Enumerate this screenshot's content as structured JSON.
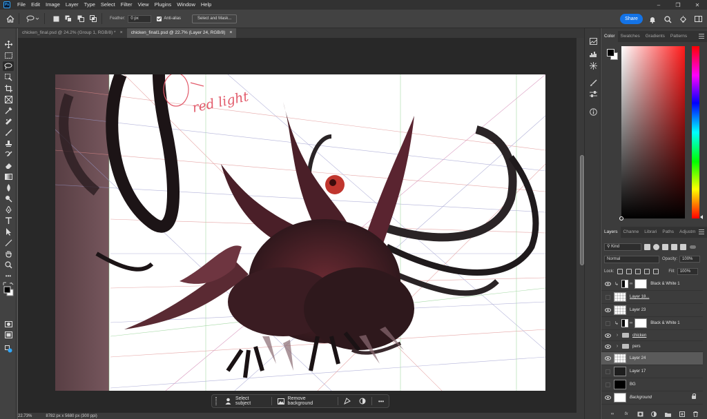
{
  "app": {
    "logo_text": "Ps",
    "menu": [
      "File",
      "Edit",
      "Image",
      "Layer",
      "Type",
      "Select",
      "Filter",
      "View",
      "Plugins",
      "Window",
      "Help"
    ],
    "window_controls": [
      "minimize",
      "restore",
      "close"
    ]
  },
  "options_bar": {
    "feather_label": "Feather:",
    "feather_value": "0 px",
    "anti_alias_label": "Anti-alias",
    "anti_alias_checked": true,
    "select_and_mask_label": "Select and Mask...",
    "share_label": "Share",
    "icons": [
      "home-icon",
      "lasso-tool-icon",
      "new-selection-icon",
      "add-selection-icon",
      "subtract-selection-icon",
      "intersect-selection-icon"
    ],
    "right_icons": [
      "bell-icon",
      "search-icon",
      "lightbulb-icon",
      "workspace-icon"
    ]
  },
  "tabs": [
    {
      "label": "chicken_final.psd @ 24.2% (Group 1, RGB/8) *",
      "active": false
    },
    {
      "label": "chicken_final1.psd @ 22.7% (Layer 24, RGB/8)",
      "active": true
    }
  ],
  "canvas": {
    "annotation_text": "red light"
  },
  "taskbar": {
    "select_subject_label": "Select subject",
    "remove_background_label": "Remove background",
    "more_label": "•••"
  },
  "status": {
    "zoom": "22.73%",
    "doc_size": "8782 px x 5680 px (300 ppi)"
  },
  "color_panel": {
    "tabs": [
      "Color",
      "Swatches",
      "Gradients",
      "Patterns"
    ],
    "active_tab": "Color",
    "foreground": "#000000",
    "background": "#ffffff",
    "hue": "#ff1a1a"
  },
  "layers_panel": {
    "tabs": [
      "Layers",
      "Channe",
      "Librari",
      "Paths",
      "Adjustm"
    ],
    "active_tab": "Layers",
    "kind_label": "Kind",
    "blend_mode": "Normal",
    "opacity_label": "Opacity:",
    "opacity": "100%",
    "lock_label": "Lock:",
    "fill_label": "Fill:",
    "fill": "100%",
    "layers": [
      {
        "name": "Black & White 1",
        "visible": true,
        "type": "adjustment",
        "clipped": true
      },
      {
        "name": "Layer 18...",
        "visible": false,
        "type": "checker",
        "underline": true
      },
      {
        "name": "Layer 23",
        "visible": true,
        "type": "checker"
      },
      {
        "name": "Black & White 1",
        "visible": false,
        "type": "adjustment",
        "clipped": true
      },
      {
        "name": "chicken",
        "visible": true,
        "type": "group",
        "underline": true
      },
      {
        "name": "pers",
        "visible": true,
        "type": "group"
      },
      {
        "name": "Layer 24",
        "visible": true,
        "type": "checker",
        "selected": true
      },
      {
        "name": "Layer 17",
        "visible": false,
        "type": "dark"
      },
      {
        "name": "BG",
        "visible": false,
        "type": "black"
      },
      {
        "name": "Background",
        "visible": true,
        "type": "white",
        "italic": true,
        "locked": true
      }
    ],
    "footer_icons": [
      "link-icon",
      "fx-icon",
      "mask-icon",
      "adjustment-icon",
      "folder-icon",
      "new-layer-icon",
      "trash-icon"
    ]
  }
}
